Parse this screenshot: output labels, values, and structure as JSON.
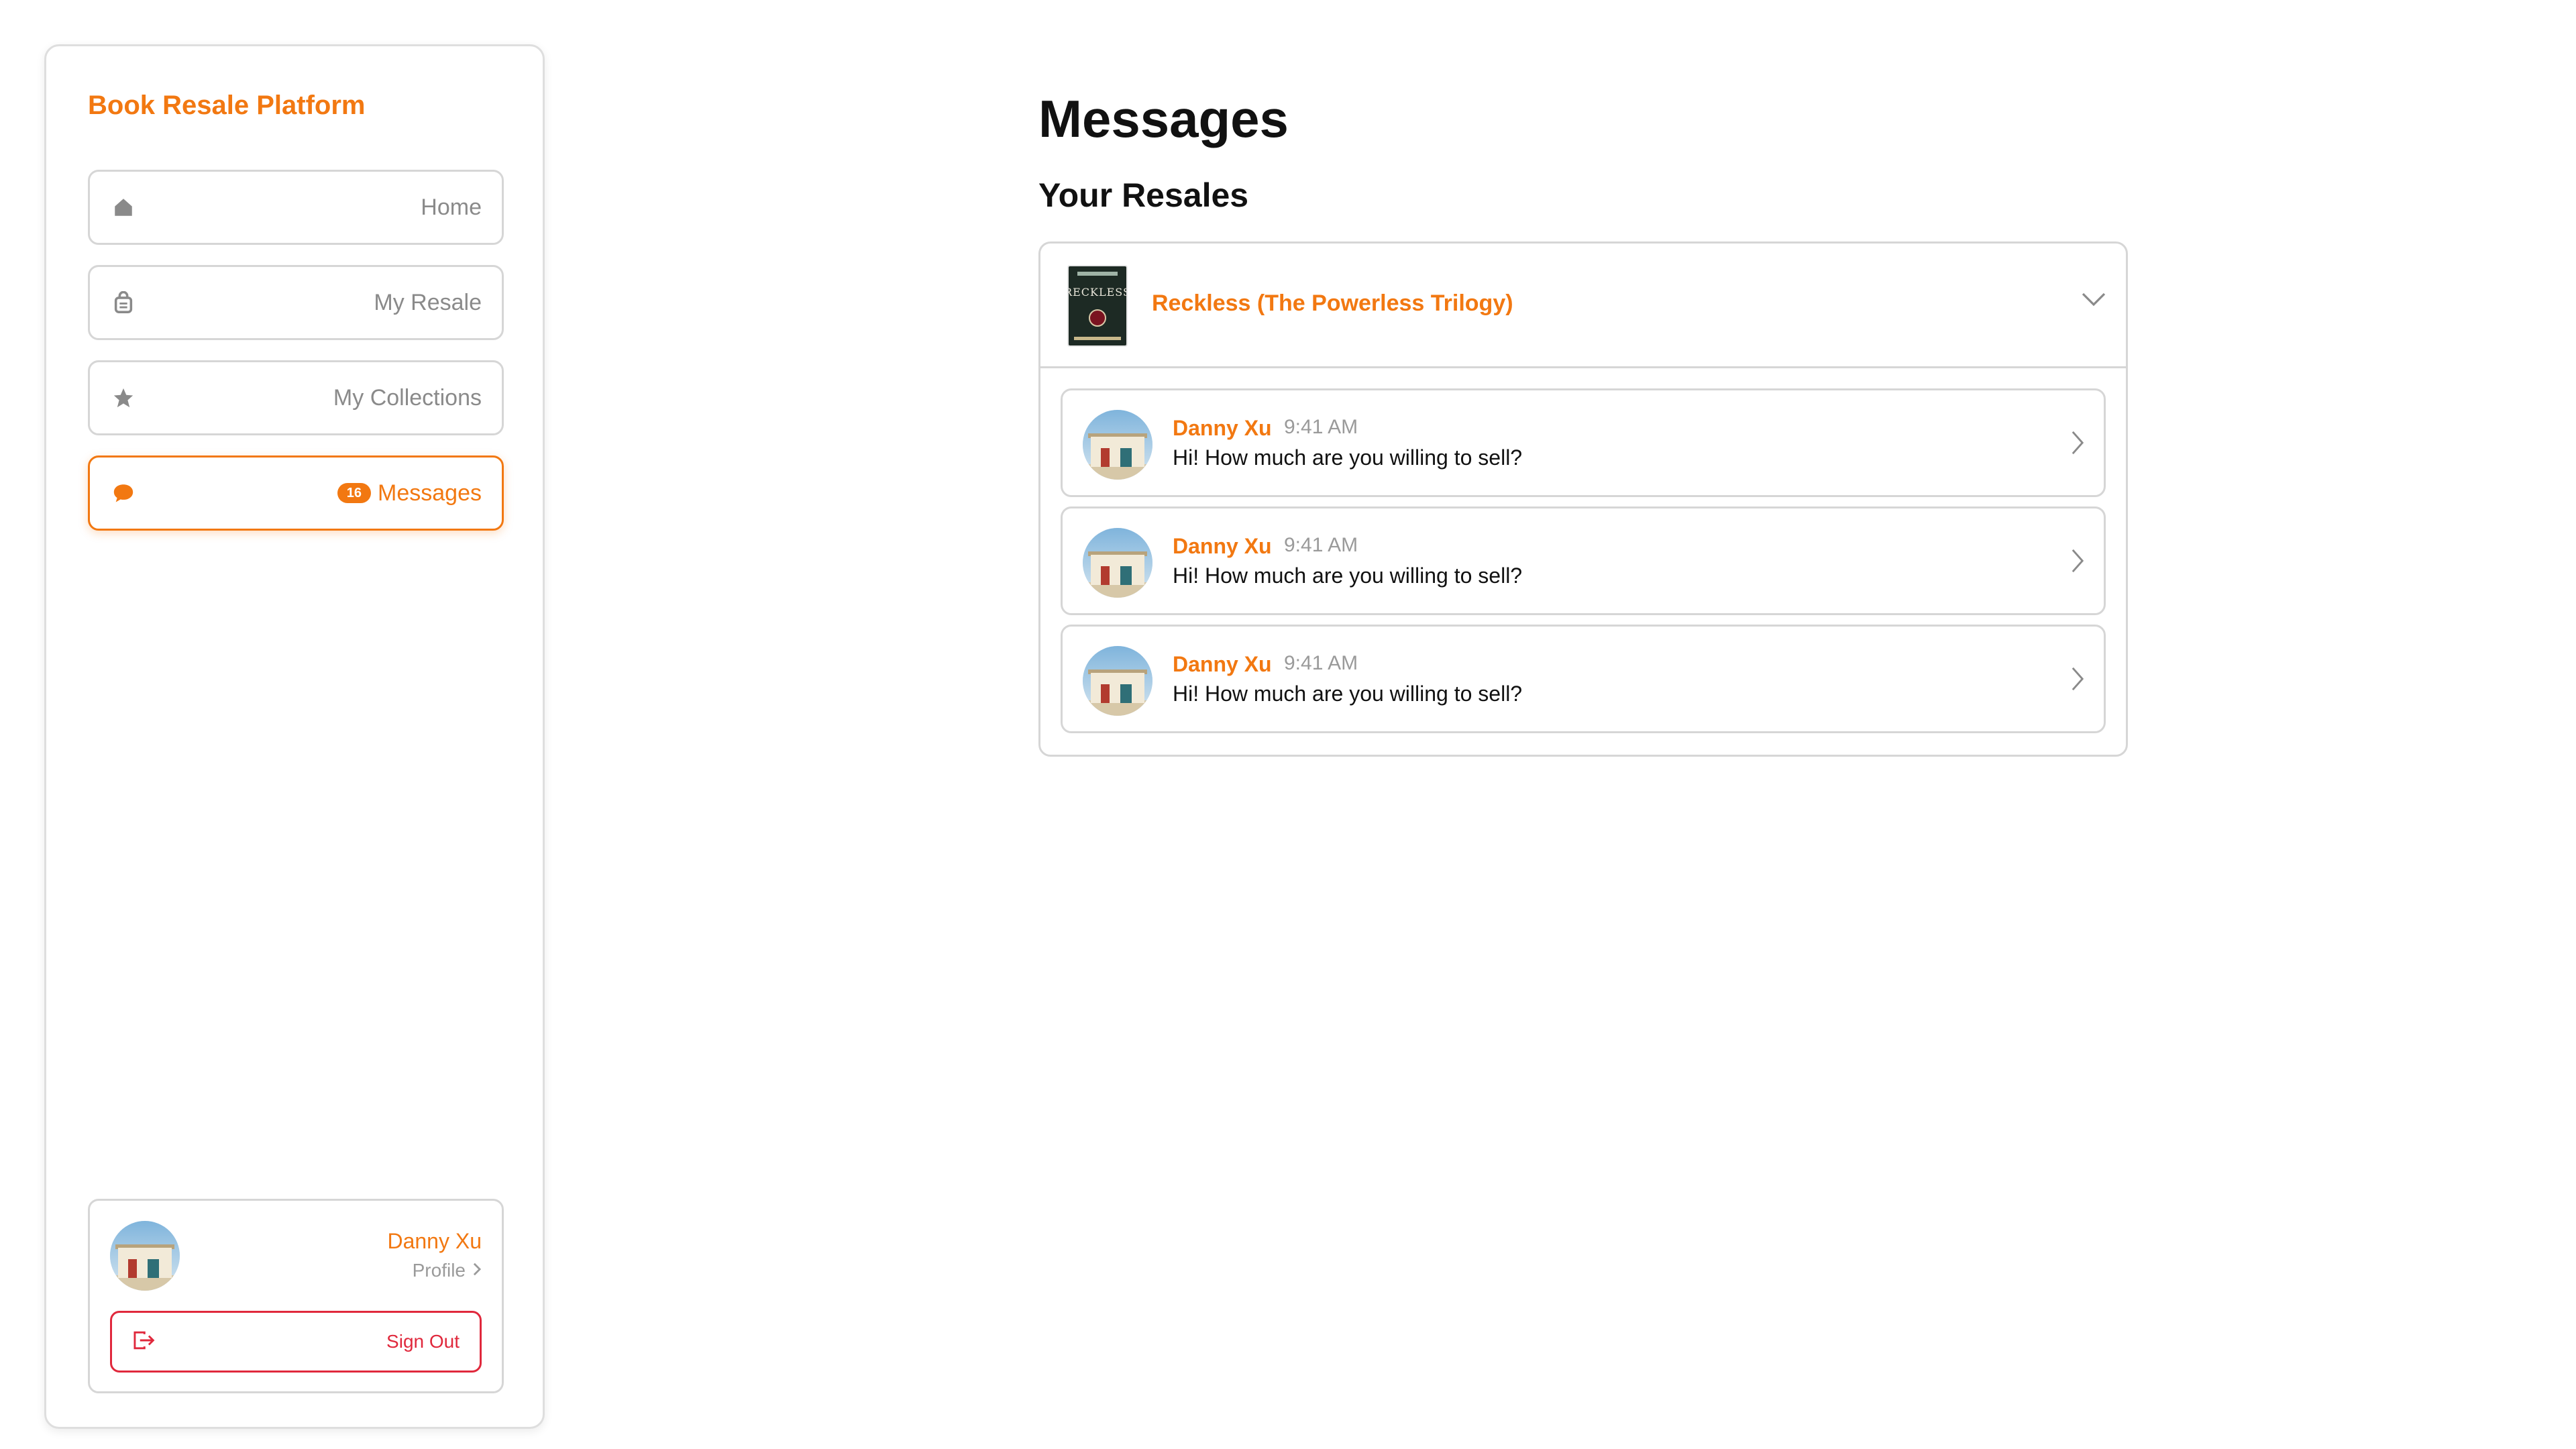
{
  "sidebar": {
    "brand": "Book Resale Platform",
    "nav": [
      {
        "label": "Home",
        "icon": "home-icon",
        "active": false
      },
      {
        "label": "My Resale",
        "icon": "bag-icon",
        "active": false
      },
      {
        "label": "My Collections",
        "icon": "star-icon",
        "active": false
      },
      {
        "label": "Messages",
        "icon": "chat-bubble-icon",
        "active": true,
        "badge": "16"
      }
    ],
    "profile": {
      "name": "Danny Xu",
      "link_label": "Profile",
      "signout_label": "Sign Out"
    }
  },
  "main": {
    "title": "Messages",
    "section_title": "Your Resales",
    "resale": {
      "book_title": "Reckless (The Powerless Trilogy)",
      "cover_text": "RECKLESS",
      "messages": [
        {
          "sender": "Danny Xu",
          "time": "9:41 AM",
          "text": "Hi! How much are you willing to sell?"
        },
        {
          "sender": "Danny Xu",
          "time": "9:41 AM",
          "text": "Hi! How much are you willing to sell?"
        },
        {
          "sender": "Danny Xu",
          "time": "9:41 AM",
          "text": "Hi! How much are you willing to sell?"
        }
      ]
    }
  },
  "colors": {
    "accent": "#f27811",
    "danger": "#e0283c",
    "muted": "#8a8a8a",
    "border": "#d6d6d6"
  }
}
